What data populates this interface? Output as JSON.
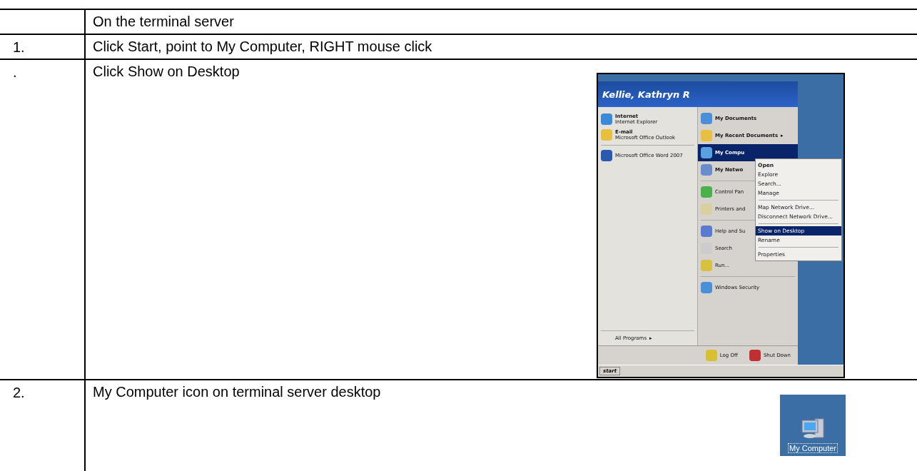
{
  "table": {
    "rows": [
      {
        "number": "",
        "text": "On the terminal server"
      },
      {
        "number": "1.",
        "text": "Click Start, point to My Computer, RIGHT mouse click"
      },
      {
        "number": ".",
        "text": "Click Show on Desktop",
        "screenshot": {
          "kind": "start_menu",
          "user": "Kellie, Kathryn R",
          "pinned": [
            {
              "title": "Internet",
              "subtitle": "Internet Explorer"
            },
            {
              "title": "E-mail",
              "subtitle": "Microsoft Office Outlook"
            }
          ],
          "recent": [
            "Microsoft Office Word 2007"
          ],
          "all_programs": "All Programs",
          "all_programs_arrow": "▸",
          "places": [
            {
              "label": "My Documents",
              "bold": true,
              "selected": false
            },
            {
              "label": "My Recent Documents",
              "bold": true,
              "selected": false,
              "arrow": "▸"
            },
            {
              "label": "My Compu",
              "bold": true,
              "selected": true
            },
            {
              "label": "My Netwo",
              "bold": true,
              "selected": false
            },
            {
              "label": "Control Pan",
              "bold": false,
              "selected": false
            },
            {
              "label": "Printers and",
              "bold": false,
              "selected": false
            },
            {
              "label": "Help and Su",
              "bold": false,
              "selected": false
            },
            {
              "label": "Search",
              "bold": false,
              "selected": false
            },
            {
              "label": "Run...",
              "bold": false,
              "selected": false
            },
            {
              "label": "Windows Security",
              "bold": false,
              "selected": false
            }
          ],
          "context_menu": [
            {
              "label": "Open",
              "bold": true,
              "selected": false
            },
            {
              "label": "Explore",
              "bold": false,
              "selected": false
            },
            {
              "label": "Search...",
              "bold": false,
              "selected": false
            },
            {
              "label": "Manage",
              "bold": false,
              "selected": false
            },
            {
              "label": "Map Network Drive...",
              "bold": false,
              "selected": false
            },
            {
              "label": "Disconnect Network Drive...",
              "bold": false,
              "selected": false
            },
            {
              "label": "Show on Desktop",
              "bold": false,
              "selected": true
            },
            {
              "label": "Rename",
              "bold": false,
              "selected": false
            },
            {
              "label": "Properties",
              "bold": false,
              "selected": false
            }
          ],
          "log_off": "Log Off",
          "shut_down": "Shut Down",
          "start": "start"
        }
      },
      {
        "number": "2.",
        "text": "My Computer icon on terminal server desktop",
        "screenshot": {
          "kind": "desktop_icon",
          "label": "My Computer"
        }
      }
    ]
  }
}
